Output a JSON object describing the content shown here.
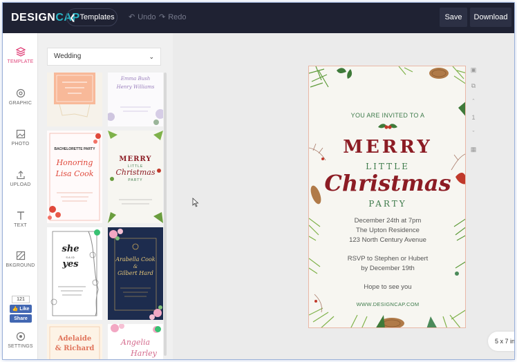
{
  "header": {
    "logo_left": "DESIGN",
    "logo_right": "CAP",
    "templates_label": "Templates",
    "undo_label": "Undo",
    "redo_label": "Redo",
    "save_label": "Save",
    "download_label": "Download"
  },
  "sidebar": {
    "items": [
      {
        "label": "TEMPLATE",
        "icon": "layers-icon"
      },
      {
        "label": "GRAPHIC",
        "icon": "graphic-icon"
      },
      {
        "label": "PHOTO",
        "icon": "photo-icon"
      },
      {
        "label": "UPLOAD",
        "icon": "upload-icon"
      },
      {
        "label": "TEXT",
        "icon": "text-icon"
      },
      {
        "label": "BKGROUND",
        "icon": "background-icon"
      },
      {
        "label": "SETTINGS",
        "icon": "settings-icon"
      }
    ],
    "facebook": {
      "count": "121",
      "like": "Like",
      "share": "Share"
    }
  },
  "panel": {
    "category": "Wedding",
    "thumbs": {
      "t2_name1": "Emma Bush",
      "t2_name2": "Henry Williams",
      "t3_line1": "Honoring",
      "t3_line2": "Lisa Cook",
      "t3_small": "BACHELORETTE PARTY",
      "t4_line1": "MERRY",
      "t4_line2": "LITTLE",
      "t4_line3": "Christmas",
      "t4_line4": "PARTY",
      "t5_line1": "she",
      "t5_line2": "SAID",
      "t5_line3": "yes",
      "t6_line1": "Arabella Cook",
      "t6_line2": "&",
      "t6_line3": "Gilbert Hard",
      "t7_line1": "Adelaide",
      "t7_line2": "& Richard",
      "t8_line1": "Angelia",
      "t8_line2": "Harley"
    }
  },
  "card": {
    "invite": "YOU ARE INVITED TO A",
    "merry": "MERRY",
    "little": "LITTLE",
    "christmas": "Christmas",
    "party": "PARTY",
    "date": "December 24th at 7pm",
    "venue": "The Upton Residence",
    "address": "123 North Century Avenue",
    "rsvp1": "RSVP to Stephen or Hubert",
    "rsvp2": "by December 19th",
    "hope": "Hope to see you",
    "website": "WWW.DESIGNCAP.COM"
  },
  "tools": {
    "page_number": "1"
  },
  "size_label": "5 x 7 in",
  "colors": {
    "topbar": "#1f2233",
    "accent": "#e0457b",
    "merry_red": "#8c1c24",
    "green_text": "#3d7a4a",
    "body_text": "#555555"
  }
}
